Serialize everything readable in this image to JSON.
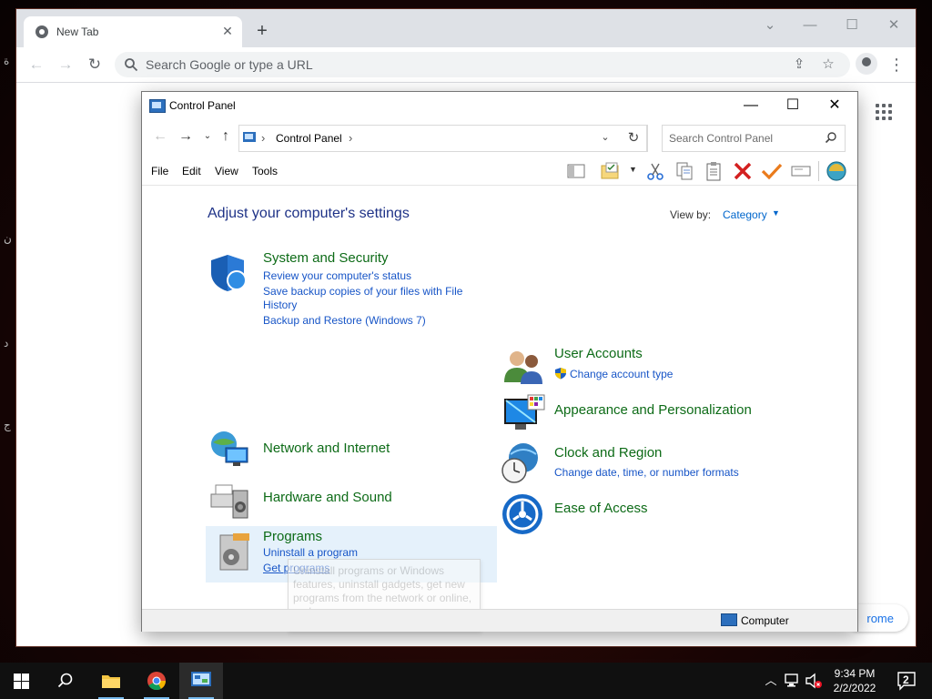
{
  "browser": {
    "tab_title": "New Tab",
    "new_tab_symbol": "+",
    "omnibox_placeholder": "Search Google or type a URL",
    "bottom_pill_text": "rome",
    "window_controls": {
      "minimize": "—",
      "maximize": "☐",
      "close": "✕",
      "tabsearch": "⌄"
    }
  },
  "control_panel": {
    "window_title": "Control Panel",
    "breadcrumb": "Control Panel",
    "search_placeholder": "Search Control Panel",
    "menu": [
      "File",
      "Edit",
      "View",
      "Tools"
    ],
    "heading": "Adjust your computer's settings",
    "view_by_label": "View by:",
    "view_by_value": "Category",
    "categories": [
      {
        "title": "System and Security",
        "links": [
          "Review your computer's status",
          "Save backup copies of your files with File",
          "History",
          "Backup and Restore (Windows 7)"
        ]
      },
      {
        "title": "Network and Internet",
        "links": []
      },
      {
        "title": "Hardware and Sound",
        "links": []
      },
      {
        "title": "Programs",
        "links": [
          "Uninstall a program",
          "Get programs"
        ]
      },
      {
        "title": "User Accounts",
        "links": [
          "Change account type"
        ]
      },
      {
        "title": "Appearance and Personalization",
        "links": []
      },
      {
        "title": "Clock and Region",
        "links": [
          "Change date, time, or number formats"
        ]
      },
      {
        "title": "Ease of Access",
        "links": []
      }
    ],
    "tooltip": "Uninstall programs or Windows features, uninstall gadgets, get new programs from the network or online, and more.",
    "status_text": "Computer"
  },
  "taskbar": {
    "time": "9:34 PM",
    "date": "2/2/2022",
    "notification_count": "2"
  },
  "colors": {
    "category_title": "#0d6b17",
    "link": "#1755c7",
    "heading": "#1e3287",
    "taskbar": "#101010"
  }
}
